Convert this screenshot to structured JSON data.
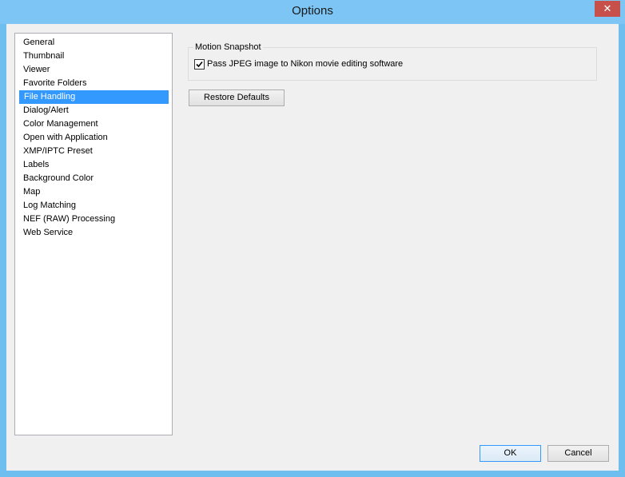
{
  "window": {
    "title": "Options",
    "close_glyph": "✕"
  },
  "nav": {
    "items": [
      {
        "label": "General",
        "selected": false
      },
      {
        "label": "Thumbnail",
        "selected": false
      },
      {
        "label": "Viewer",
        "selected": false
      },
      {
        "label": "Favorite Folders",
        "selected": false
      },
      {
        "label": "File Handling",
        "selected": true
      },
      {
        "label": "Dialog/Alert",
        "selected": false
      },
      {
        "label": "Color Management",
        "selected": false
      },
      {
        "label": "Open with Application",
        "selected": false
      },
      {
        "label": "XMP/IPTC Preset",
        "selected": false
      },
      {
        "label": "Labels",
        "selected": false
      },
      {
        "label": "Background Color",
        "selected": false
      },
      {
        "label": "Map",
        "selected": false
      },
      {
        "label": "Log Matching",
        "selected": false
      },
      {
        "label": "NEF (RAW) Processing",
        "selected": false
      },
      {
        "label": "Web Service",
        "selected": false
      }
    ]
  },
  "panel": {
    "group_title": "Motion Snapshot",
    "checkbox_label": "Pass JPEG image to Nikon movie editing software",
    "checkbox_checked": true,
    "restore_label": "Restore Defaults"
  },
  "footer": {
    "ok_label": "OK",
    "cancel_label": "Cancel"
  },
  "colors": {
    "title_bar": "#7cc5f4",
    "close_button": "#c7514a",
    "selection": "#3399ff"
  }
}
